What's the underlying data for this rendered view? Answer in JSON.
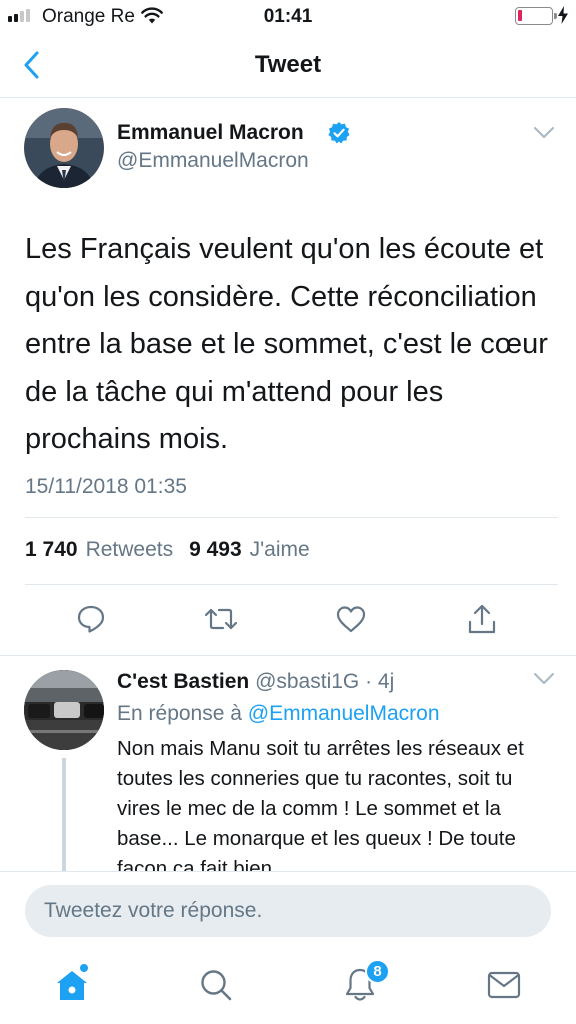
{
  "status_bar": {
    "carrier": "Orange Re",
    "time": "01:41",
    "signal_bars": 4,
    "signal_bars_filled": 2,
    "battery_level": 0.08,
    "battery_color": "#e0245e"
  },
  "nav": {
    "title": "Tweet",
    "back_icon": "chevron-left-icon"
  },
  "tweet": {
    "author_name": "Emmanuel Macron",
    "author_handle": "@EmmanuelMacron",
    "verified_icon": "verified-badge-icon",
    "text": "Les Français veulent qu'on les écoute et qu'on les considère. Cette réconciliation entre la base et le sommet, c'est le cœur de la tâche qui m'attend pour les prochains mois.",
    "date": "15/11/2018 01:35",
    "retweets_count": "1 740",
    "retweets_label": "Retweets",
    "likes_count": "9 493",
    "likes_label": "J'aime",
    "actions": [
      "reply-icon",
      "retweet-icon",
      "like-icon",
      "share-icon"
    ]
  },
  "reply": {
    "author_name": "C'est Bastien",
    "author_meta": "@sbasti1G · 4j",
    "in_reply_prefix": "En réponse à",
    "in_reply_mention": "@EmmanuelMacron",
    "text": "Non mais Manu soit tu arrêtes les réseaux et toutes les conneries que tu racontes, soit tu vires le mec de la comm ! Le sommet et la base... Le monarque et les queux ! De toute façon ça fait bien"
  },
  "compose": {
    "placeholder": "Tweetez votre réponse."
  },
  "tab_bar": {
    "items": [
      "home-icon",
      "search-icon",
      "notifications-icon",
      "messages-icon"
    ],
    "notifications_badge": "8"
  },
  "colors": {
    "accent": "#1da1f2",
    "secondary_text": "#657786",
    "divider": "#e1e8ed"
  }
}
